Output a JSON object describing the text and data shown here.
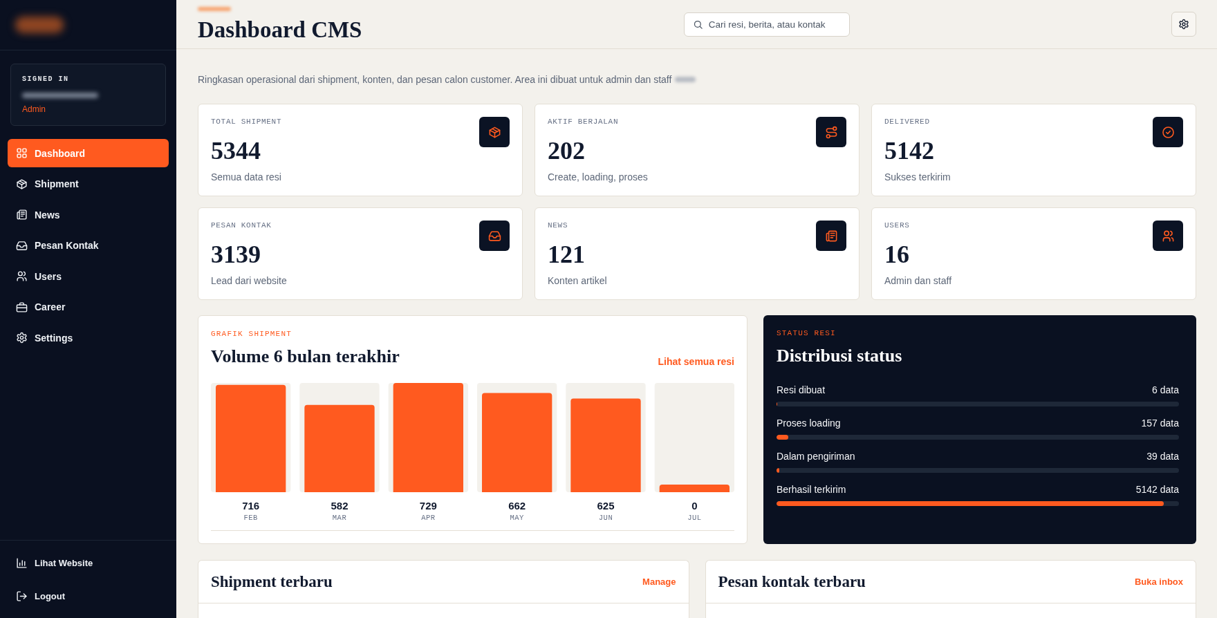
{
  "sidebar": {
    "signed_in": {
      "label": "SIGNED IN",
      "role": "Admin"
    },
    "nav": [
      {
        "label": "Dashboard",
        "selected": true
      },
      {
        "label": "Shipment",
        "selected": false
      },
      {
        "label": "News",
        "selected": false
      },
      {
        "label": "Pesan Kontak",
        "selected": false
      },
      {
        "label": "Users",
        "selected": false
      },
      {
        "label": "Career",
        "selected": false
      },
      {
        "label": "Settings",
        "selected": false
      }
    ],
    "footer": [
      {
        "label": "Lihat Website"
      },
      {
        "label": "Logout"
      }
    ]
  },
  "header": {
    "title": "Dashboard CMS",
    "search": {
      "placeholder": "Cari resi, berita, atau kontak"
    }
  },
  "intro": "Ringkasan operasional dari shipment, konten, dan pesan calon customer. Area ini dibuat untuk admin dan staff",
  "stats": [
    {
      "label": "TOTAL SHIPMENT",
      "value": "5344",
      "caption": "Semua data resi"
    },
    {
      "label": "AKTIF BERJALAN",
      "value": "202",
      "caption": "Create, loading, proses"
    },
    {
      "label": "DELIVERED",
      "value": "5142",
      "caption": "Sukses terkirim"
    },
    {
      "label": "PESAN KONTAK",
      "value": "3139",
      "caption": "Lead dari website"
    },
    {
      "label": "NEWS",
      "value": "121",
      "caption": "Konten artikel"
    },
    {
      "label": "USERS",
      "value": "16",
      "caption": "Admin dan staff"
    }
  ],
  "chart_card": {
    "eyebrow": "GRAFIK SHIPMENT",
    "title": "Volume 6 bulan terakhir",
    "link": "Lihat semua resi",
    "chart_data": {
      "type": "bar",
      "categories": [
        "FEB",
        "MAR",
        "APR",
        "MAY",
        "JUN",
        "JUL"
      ],
      "values": [
        716,
        582,
        729,
        662,
        625,
        0
      ],
      "data_labels": true
    }
  },
  "status_card": {
    "eyebrow": "STATUS RESI",
    "title": "Distribusi status",
    "rows": [
      {
        "label": "Resi dibuat",
        "reading": "6 data",
        "level": 0.001
      },
      {
        "label": "Proses loading",
        "reading": "157 data",
        "level": 0.029
      },
      {
        "label": "Dalam pengiriman",
        "reading": "39 data",
        "level": 0.007
      },
      {
        "label": "Berhasil terkirim",
        "reading": "5142 data",
        "level": 0.962
      }
    ]
  },
  "panels": [
    {
      "title": "Shipment terbaru",
      "link": "Manage"
    },
    {
      "title": "Pesan kontak terbaru",
      "link": "Buka inbox"
    }
  ]
}
